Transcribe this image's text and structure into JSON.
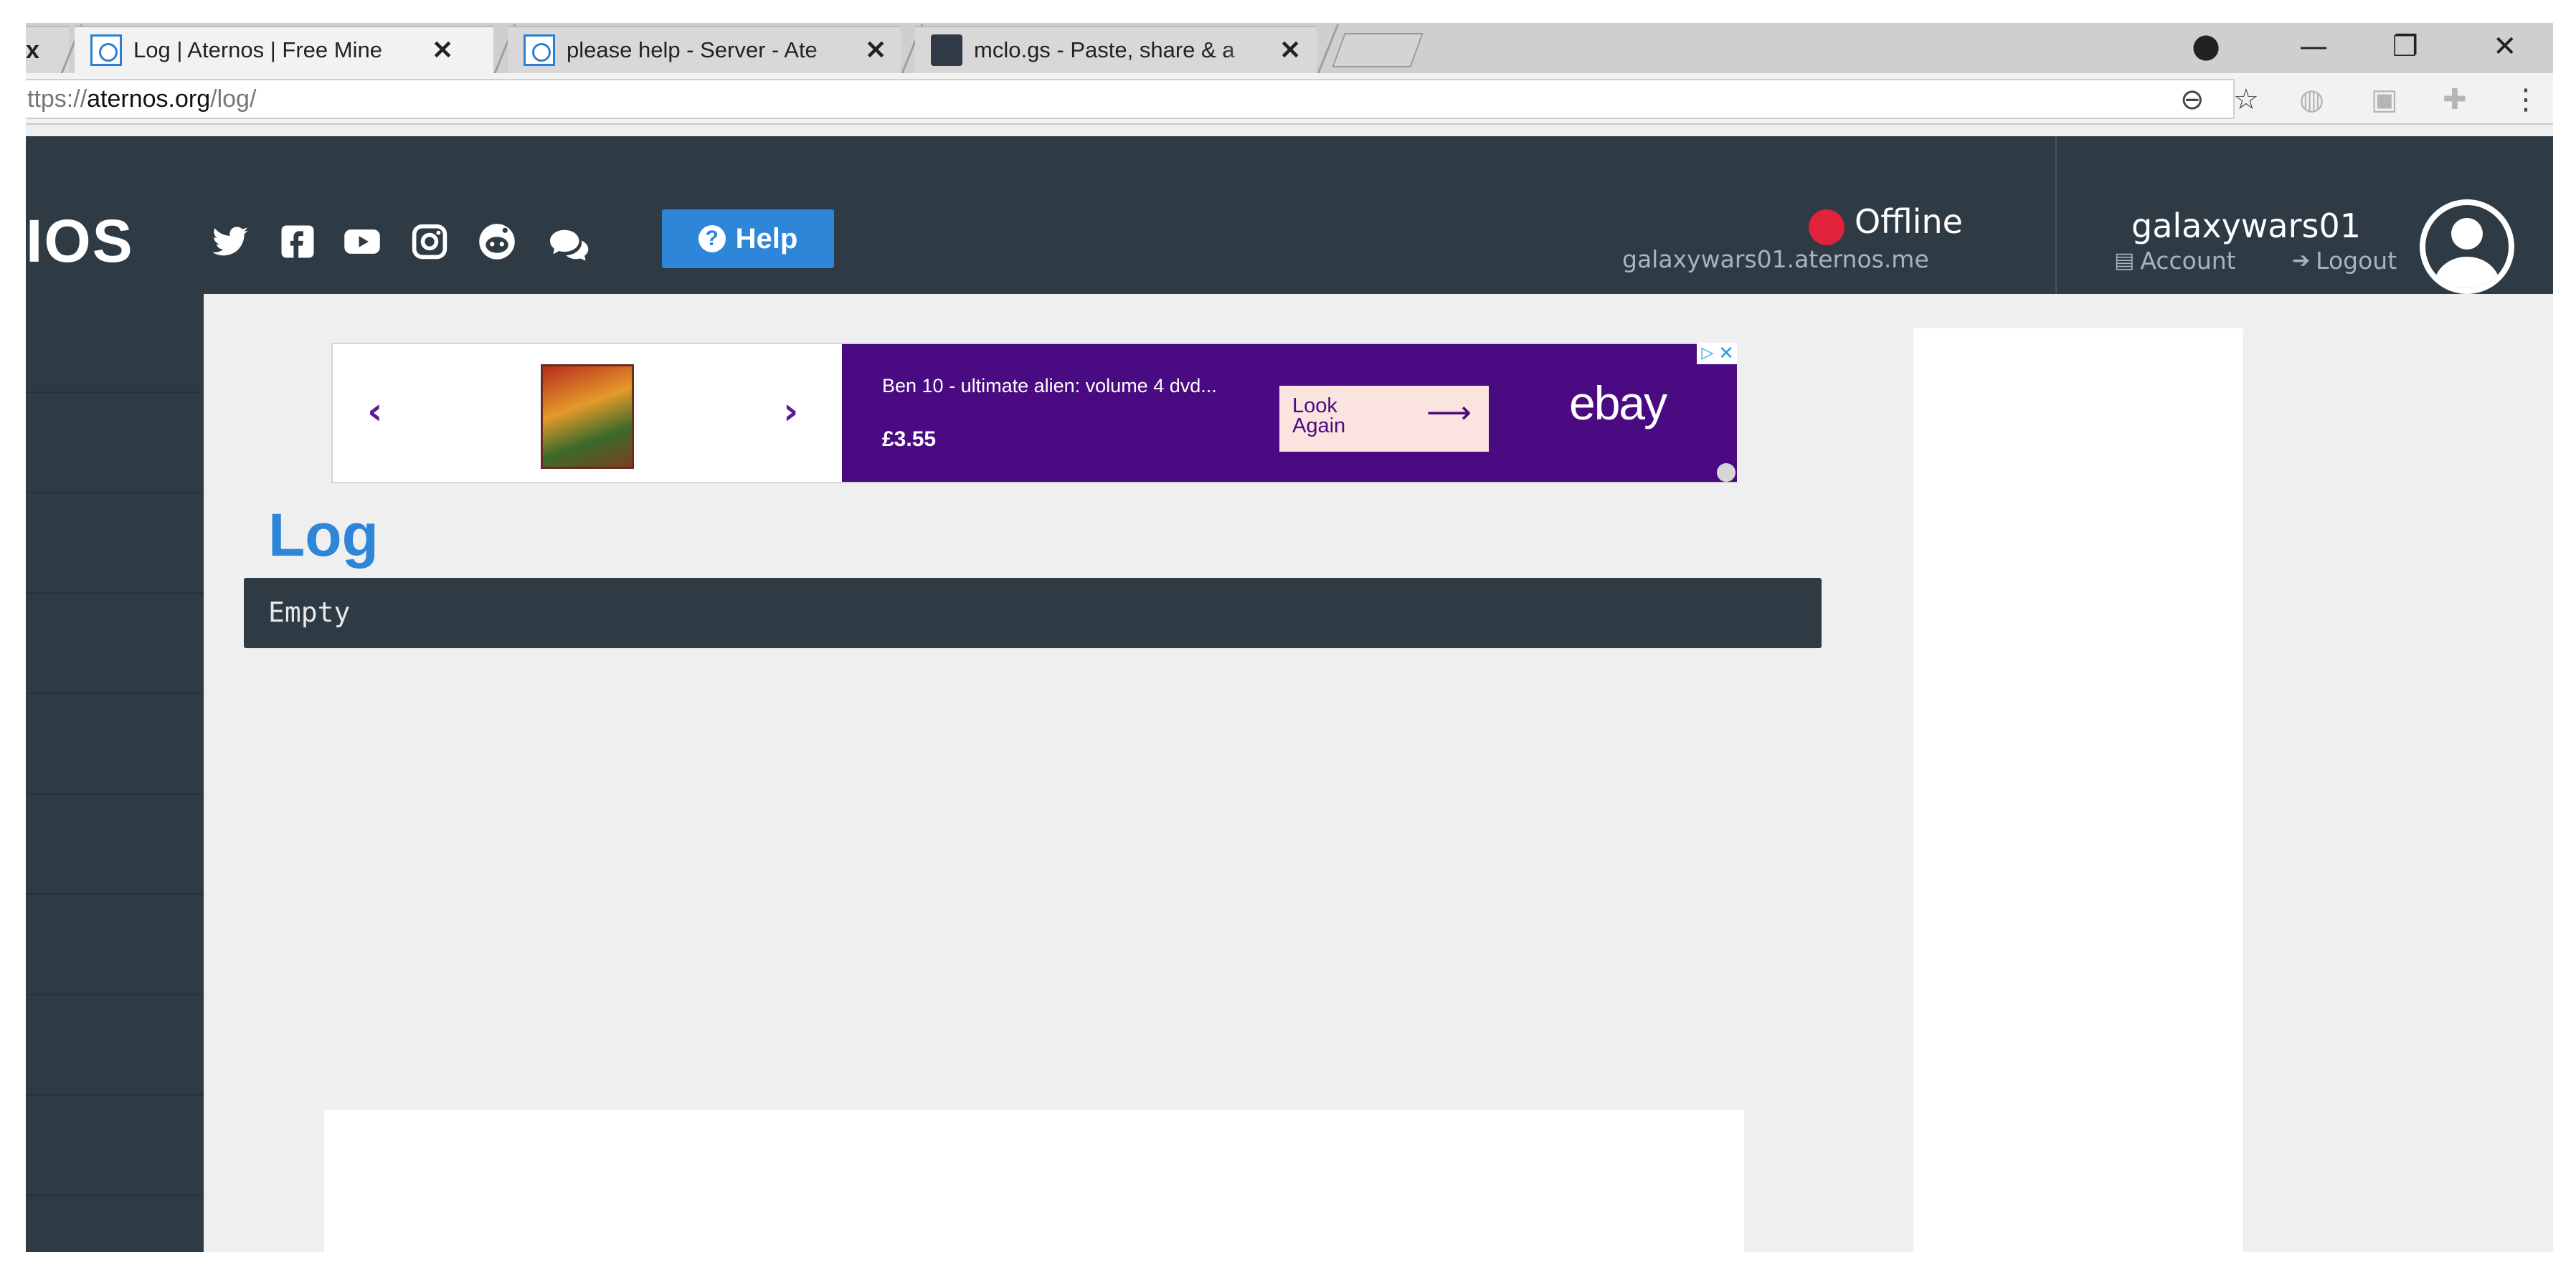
{
  "browser": {
    "tabs": [
      {
        "title": "Log | Aternos | Free Mine",
        "active": true,
        "icon": "aternos-favicon"
      },
      {
        "title": "please help - Server - Ate",
        "active": false,
        "icon": "aternos-favicon"
      },
      {
        "title": "mclo.gs - Paste, share & a",
        "active": false,
        "icon": "mclo-favicon"
      }
    ],
    "close_glyph": "✕",
    "partial_tab_close": "x",
    "window_controls": {
      "profile": "profile-icon",
      "minimize": "—",
      "restore": "❐",
      "close": "✕"
    },
    "url_scheme_partial": "ttps://",
    "url_host": "aternos.org",
    "url_path": "/log/"
  },
  "header": {
    "logo_partial": "IOS",
    "social_icons": [
      "twitter-icon",
      "facebook-icon",
      "youtube-icon",
      "instagram-icon",
      "reddit-icon",
      "chat-icon"
    ],
    "help_label": "Help",
    "help_icon_glyph": "?",
    "status_text": "Offline",
    "status_color": "#e0223a",
    "server_address": "galaxywars01.aternos.me",
    "username": "galaxywars01",
    "account_label": "Account",
    "logout_label": "Logout"
  },
  "ad": {
    "product_title": "Ben 10 - ultimate alien: volume 4 dvd...",
    "price": "£3.55",
    "cta_label": "Look Again",
    "brand": "ebay",
    "prev_glyph": "‹",
    "next_glyph": "›",
    "adchoices_glyph": "▷",
    "close_glyph": "✕"
  },
  "main": {
    "page_title": "Log",
    "log_content": "Empty"
  },
  "colors": {
    "accent": "#2d86d8",
    "header_bg": "#2e3a44",
    "ad_purple": "#4a0b82"
  }
}
